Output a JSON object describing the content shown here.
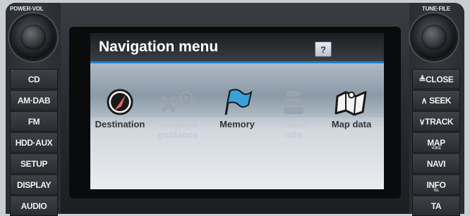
{
  "hardware": {
    "left_knob_label": "POWER·VOL",
    "right_knob_label": "TUNE·FILE",
    "left_buttons": [
      "CD",
      "AM·DAB",
      "FM",
      "HDD·AUX",
      "SETUP",
      "DISPLAY",
      "AUDIO"
    ],
    "right_buttons": [
      {
        "label": "≜CLOSE",
        "sub": ""
      },
      {
        "label": "∧ SEEK",
        "sub": ""
      },
      {
        "label": "∨TRACK",
        "sub": ""
      },
      {
        "label": "MAP",
        "sub": "VOICE"
      },
      {
        "label": "NAVI",
        "sub": ""
      },
      {
        "label": "INFO",
        "sub": "TEL"
      },
      {
        "label": "TA",
        "sub": ""
      }
    ]
  },
  "screen": {
    "title": "Navigation menu",
    "help_label": "?",
    "accent_color": "#1f7fc7",
    "menu_items": [
      {
        "label": "Destination",
        "icon": "compass-icon",
        "enabled": true
      },
      {
        "label": "Suspend\nguidance",
        "icon": "route-pin-icon",
        "enabled": false
      },
      {
        "label": "Memory",
        "icon": "flag-icon",
        "enabled": true
      },
      {
        "label": "Traffic\ninfo",
        "icon": "traffic-cars-icon",
        "enabled": false
      },
      {
        "label": "Map data",
        "icon": "map-icon",
        "enabled": true
      }
    ]
  }
}
